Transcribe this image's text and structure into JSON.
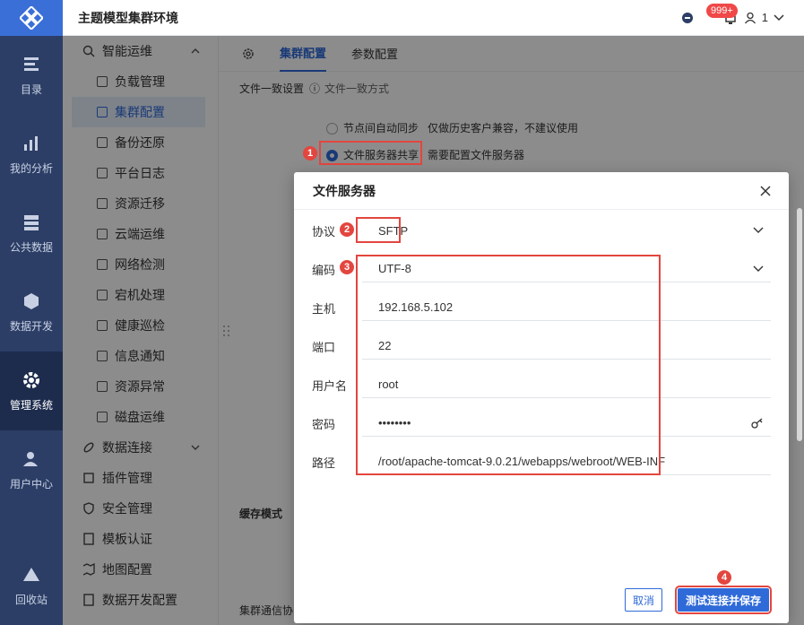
{
  "app": {
    "title": "主题模型集群环境",
    "notify_badge": "999+",
    "user": "1"
  },
  "leftnav": [
    {
      "label": "目录"
    },
    {
      "label": "我的分析"
    },
    {
      "label": "公共数据"
    },
    {
      "label": "数据开发"
    },
    {
      "label": "管理系统"
    },
    {
      "label": "用户中心"
    },
    {
      "label": "回收站"
    }
  ],
  "menu": {
    "group1": "智能运维",
    "items": [
      "负载管理",
      "集群配置",
      "备份还原",
      "平台日志",
      "资源迁移",
      "云端运维",
      "网络检测",
      "宕机处理",
      "健康巡检",
      "信息通知",
      "资源异常",
      "磁盘运维"
    ],
    "groups": [
      "数据连接",
      "插件管理",
      "安全管理",
      "模板认证",
      "地图配置",
      "数据开发配置"
    ]
  },
  "tabs": [
    "集群配置",
    "参数配置"
  ],
  "bg": {
    "section": "文件一致设置",
    "section_hint": "文件一致方式",
    "opt1": "节点间自动同步",
    "opt1_note": "仅做历史客户兼容，不建议使用",
    "opt2": "文件服务器共享",
    "opt2_note": "需要配置文件服务器",
    "cache": "缓存模式",
    "cluster_comm": "集群通信协"
  },
  "dialog": {
    "title": "文件服务器",
    "fields": [
      {
        "label": "协议",
        "value": "SFTP"
      },
      {
        "label": "编码",
        "value": "UTF-8"
      },
      {
        "label": "主机",
        "value": "192.168.5.102"
      },
      {
        "label": "端口",
        "value": "22"
      },
      {
        "label": "用户名",
        "value": "root"
      },
      {
        "label": "密码",
        "value": "••••••••"
      },
      {
        "label": "路径",
        "value": "/root/apache-tomcat-9.0.21/webapps/webroot/WEB-INF"
      }
    ],
    "cancel": "取消",
    "save": "测试连接并保存"
  },
  "markers": [
    "1",
    "2",
    "3",
    "4"
  ],
  "colors": {
    "accent": "#2f6ad9",
    "marker": "#e3463f",
    "nav": "#2c3e66"
  }
}
